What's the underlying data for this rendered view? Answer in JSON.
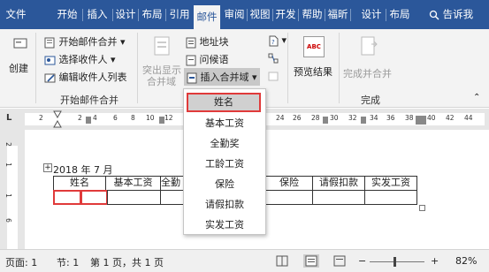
{
  "tabs": [
    {
      "label": "文件",
      "active": false
    },
    {
      "label": "开始",
      "active": false
    },
    {
      "label": "插入",
      "active": false
    },
    {
      "label": "设计",
      "active": false
    },
    {
      "label": "布局",
      "active": false
    },
    {
      "label": "引用",
      "active": false
    },
    {
      "label": "邮件",
      "active": true
    },
    {
      "label": "审阅",
      "active": false
    },
    {
      "label": "视图",
      "active": false
    },
    {
      "label": "开发",
      "active": false
    },
    {
      "label": "帮助",
      "active": false
    },
    {
      "label": "福昕",
      "active": false
    },
    {
      "label": "设计",
      "active": false
    },
    {
      "label": "布局",
      "active": false
    }
  ],
  "search": {
    "label": "告诉我"
  },
  "ribbon": {
    "create": "创建",
    "start_merge": "开始邮件合并",
    "select_recipients": "选择收件人",
    "edit_recipients": "编辑收件人列表",
    "group_start": "开始邮件合并",
    "highlight_line1": "突出显示",
    "highlight_line2": "合并域",
    "address_block": "地址块",
    "greeting_line": "问候语",
    "insert_merge_field": "插入合并域",
    "preview_results": "预览结果",
    "preview_icon_text": "ABC",
    "finish_merge": "完成并合并",
    "group_finish": "完成"
  },
  "ruler_ticks": [
    "2",
    "2",
    "4",
    "6",
    "8",
    "10",
    "12",
    "24",
    "26",
    "28",
    "30",
    "32",
    "34",
    "36",
    "38",
    "40",
    "42",
    "44"
  ],
  "vruler_ticks": [
    "2",
    "1",
    "1",
    "6"
  ],
  "ruler_corner": "L",
  "document": {
    "date_text": "2018 年 7 月",
    "table_headers": [
      "姓名",
      "基本工资",
      "全勤",
      "保险",
      "请假扣款",
      "实发工资"
    ]
  },
  "merge_fields_menu": [
    "姓名",
    "基本工资",
    "全勤奖",
    "工龄工资",
    "保险",
    "请假扣款",
    "实发工资"
  ],
  "status": {
    "page": "页面: 1",
    "section": "节: 1",
    "page_of": "第 1 页，共 1 页",
    "zoom": "82%",
    "zoom_minus": "−",
    "zoom_plus": "+"
  },
  "colors": {
    "tab_bar": "#2b579a",
    "ribbon_bg": "#f3f3f3",
    "highlight_border": "#e03a3a"
  }
}
